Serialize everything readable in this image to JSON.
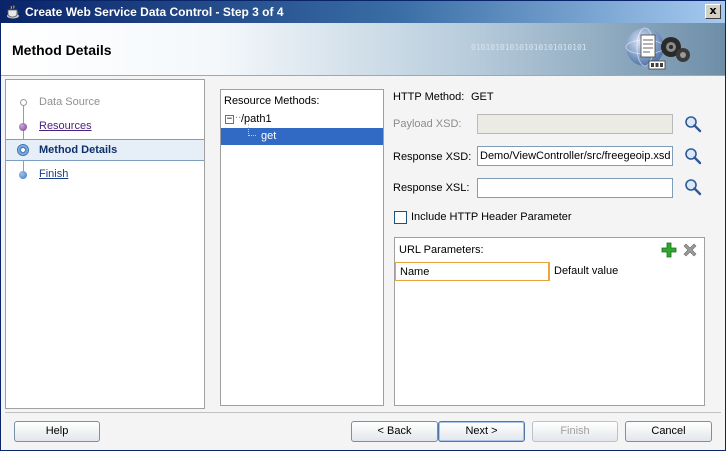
{
  "window": {
    "title": "Create Web Service Data Control - Step 3 of 4",
    "close_label": "x"
  },
  "header": {
    "heading": "Method Details",
    "binary_text": "010101010101010101010101"
  },
  "nav": {
    "items": [
      {
        "label": "Data Source",
        "state": "disabled"
      },
      {
        "label": "Resources",
        "state": "done"
      },
      {
        "label": "Method Details",
        "state": "active"
      },
      {
        "label": "Finish",
        "state": "pending"
      }
    ]
  },
  "resources": {
    "caption": "Resource Methods:",
    "root_label": "/path1",
    "root_toggle": "−",
    "tree_dots": "··",
    "child_label": "get"
  },
  "method": {
    "http_method_label": "HTTP Method:",
    "http_method_value": "GET",
    "payload_xsd_label": "Payload XSD:",
    "payload_xsd_value": "",
    "response_xsd_label": "Response XSD:",
    "response_xsd_value": "Demo/ViewController/src/freegeoip.xsd",
    "response_xsl_label": "Response XSL:",
    "response_xsl_value": "",
    "include_header_label": "Include HTTP Header Parameter",
    "include_header_checked": false
  },
  "url_params": {
    "caption": "URL Parameters:",
    "columns": [
      "Name",
      "Default value"
    ],
    "rows": []
  },
  "footer": {
    "help_label": "Help",
    "back_label": "< Back",
    "next_label": "Next >",
    "finish_label": "Finish",
    "cancel_label": "Cancel"
  }
}
